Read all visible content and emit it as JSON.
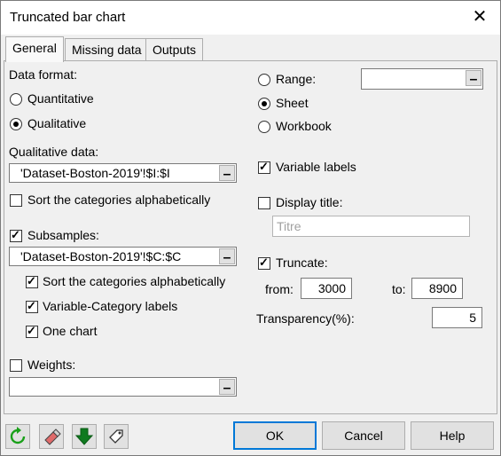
{
  "window": {
    "title": "Truncated bar chart",
    "close_glyph": "✕"
  },
  "tabs": [
    {
      "label": "General",
      "active": true
    },
    {
      "label": "Missing data",
      "active": false
    },
    {
      "label": "Outputs",
      "active": false
    }
  ],
  "general": {
    "data_format": {
      "label": "Data format:",
      "options": [
        {
          "label": "Quantitative",
          "selected": false
        },
        {
          "label": "Qualitative",
          "selected": true
        }
      ]
    },
    "qualitative_data": {
      "label": "Qualitative data:",
      "value": "'Dataset-Boston-2019'!$I:$I"
    },
    "sort_alpha_1": {
      "label": "Sort the categories alphabetically",
      "checked": false
    },
    "subsamples": {
      "label": "Subsamples:",
      "checked": true,
      "value": "'Dataset-Boston-2019'!$C:$C"
    },
    "sort_alpha_2": {
      "label": "Sort the categories alphabetically",
      "checked": true
    },
    "variable_category_labels": {
      "label": "Variable-Category labels",
      "checked": true
    },
    "one_chart": {
      "label": "One chart",
      "checked": true
    },
    "weights": {
      "label": "Weights:",
      "checked": false,
      "value": ""
    },
    "output_location": {
      "options": [
        {
          "label": "Range:",
          "selected": false
        },
        {
          "label": "Sheet",
          "selected": true
        },
        {
          "label": "Workbook",
          "selected": false
        }
      ],
      "range_value": ""
    },
    "variable_labels": {
      "label": "Variable labels",
      "checked": true
    },
    "display_title": {
      "label": "Display title:",
      "checked": false,
      "placeholder": "Titre"
    },
    "truncate": {
      "label": "Truncate:",
      "checked": true,
      "from_label": "from:",
      "from_value": "3000",
      "to_label": "to:",
      "to_value": "8900"
    },
    "transparency": {
      "label": "Transparency(%):",
      "value": "5"
    }
  },
  "footer": {
    "icons": [
      "refresh-icon",
      "eraser-icon",
      "download-arrow-icon",
      "tag-icon"
    ],
    "ok_label": "OK",
    "cancel_label": "Cancel",
    "help_label": "Help"
  },
  "colors": {
    "accent": "#0078d7",
    "green": "#19a019"
  }
}
